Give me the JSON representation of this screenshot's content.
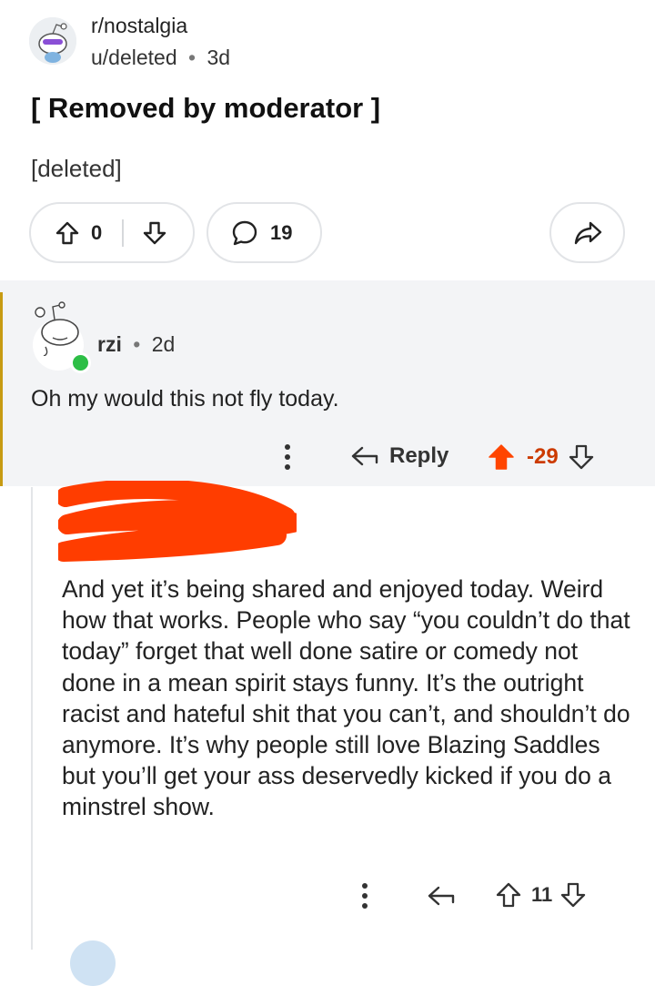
{
  "post": {
    "subreddit": "r/nostalgia",
    "author": "u/deleted",
    "age": "3d",
    "title": "[ Removed by moderator ]",
    "body": "[deleted]",
    "score": "0",
    "comment_count": "19"
  },
  "comment": {
    "user": "rzi",
    "age": "2d",
    "text": "Oh my would this not fly today.",
    "reply_label": "Reply",
    "score": "-29"
  },
  "reply": {
    "text": "And yet it’s being shared and enjoyed today. Weird how that works. People who say “you couldn’t do that today” forget that well done satire or comedy not done in a mean spirit stays funny. It’s the outright racist and hateful shit that you can’t, and shouldn’t do anymore. It’s why people still love Blazing Saddles but you’ll get your ass deservedly kicked if you do a minstrel show.",
    "score": "11"
  },
  "separator": "•",
  "icons": {
    "upvote": "arrow-up-icon",
    "downvote": "arrow-down-icon",
    "comment": "speech-bubble-icon",
    "share": "share-arrow-icon",
    "more": "vertical-dots-icon",
    "reply": "reply-arrow-icon",
    "upvote_active": "filled-arrow-up-icon"
  },
  "colors": {
    "downvoted_score": "#cc3b00",
    "upvoted_arrow": "#ff4500",
    "online": "#2dbe46",
    "highlight_bar": "#c79b12",
    "highlight_bg": "#f3f4f6"
  }
}
